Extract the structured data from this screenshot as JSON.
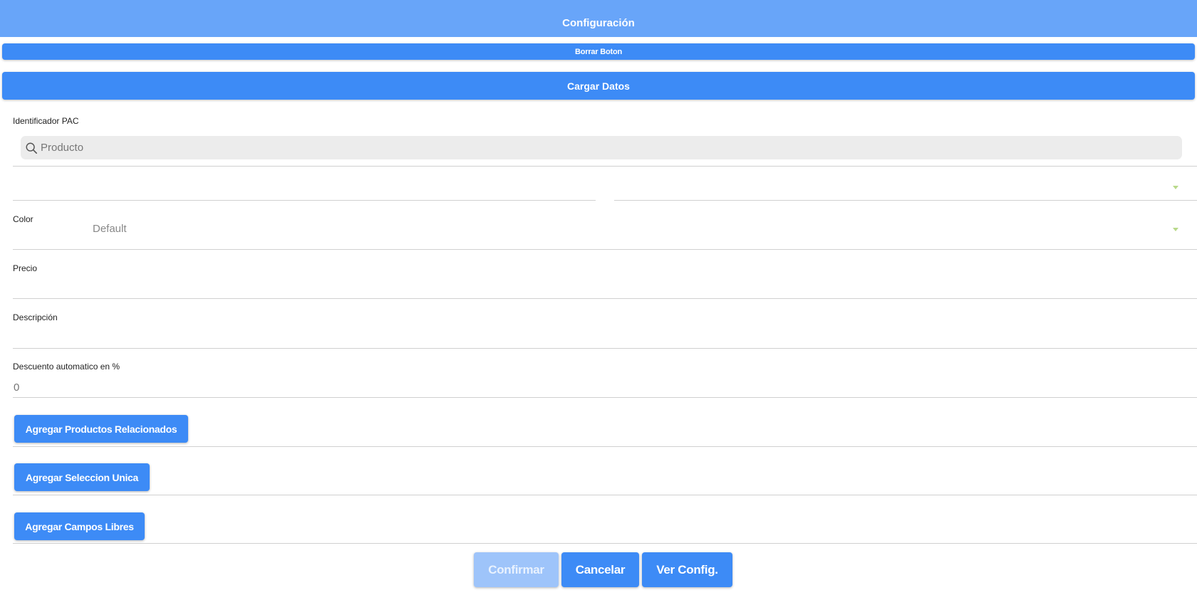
{
  "header": {
    "title": "Configuración"
  },
  "actions": {
    "borrar_label": "Borrar Boton",
    "cargar_label": "Cargar Datos"
  },
  "form": {
    "identificador": {
      "label": "Identificador PAC",
      "placeholder": "Producto",
      "value": ""
    },
    "color": {
      "label": "Color",
      "selected": "Default"
    },
    "precio": {
      "label": "Precio",
      "value": ""
    },
    "descripcion": {
      "label": "Descripción",
      "value": ""
    },
    "descuento": {
      "label": "Descuento automatico en %",
      "placeholder": "0",
      "value": ""
    }
  },
  "add_buttons": {
    "relacionados": "Agregar Productos Relacionados",
    "seleccion_unica": "Agregar Seleccion Unica",
    "campos_libres": "Agregar Campos Libres"
  },
  "footer": {
    "confirmar": "Confirmar",
    "cancelar": "Cancelar",
    "ver_config": "Ver Config."
  },
  "colors": {
    "header_bg": "#68a5f9",
    "primary": "#3d8bf6",
    "disabled": "#9ec4fa",
    "search_bg": "#ececec",
    "caret": "#b8d98a"
  },
  "icons": {
    "search": "search-icon",
    "dropdown": "chevron-down-icon"
  }
}
